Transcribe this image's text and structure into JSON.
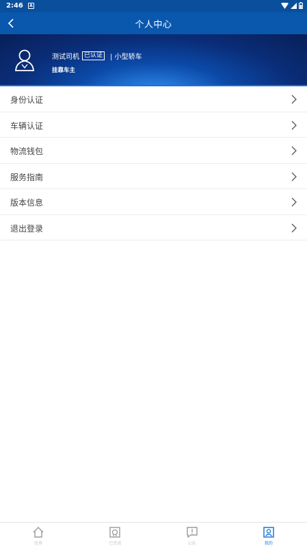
{
  "status_bar": {
    "time": "2:46",
    "notif_glyph": "A"
  },
  "header": {
    "title": "个人中心"
  },
  "profile": {
    "name": "测试司机",
    "verified_badge": "已认证",
    "car_type": "| 小型轿车",
    "role": "挂靠车主"
  },
  "menu": {
    "items": [
      {
        "label": "身份认证"
      },
      {
        "label": "车辆认证"
      },
      {
        "label": "物流钱包"
      },
      {
        "label": "服务指南"
      },
      {
        "label": "版本信息"
      },
      {
        "label": "退出登录"
      }
    ]
  },
  "tabbar": {
    "tabs": [
      {
        "label": "任务",
        "icon": "home-icon"
      },
      {
        "label": "已完成",
        "icon": "completed-icon"
      },
      {
        "label": "公告",
        "icon": "announcement-icon"
      },
      {
        "label": "我的",
        "icon": "profile-icon",
        "active": true
      }
    ]
  },
  "colors": {
    "primary": "#0a58ad",
    "active_tab": "#2b7de0",
    "inactive_tab": "#c8c8c8"
  }
}
